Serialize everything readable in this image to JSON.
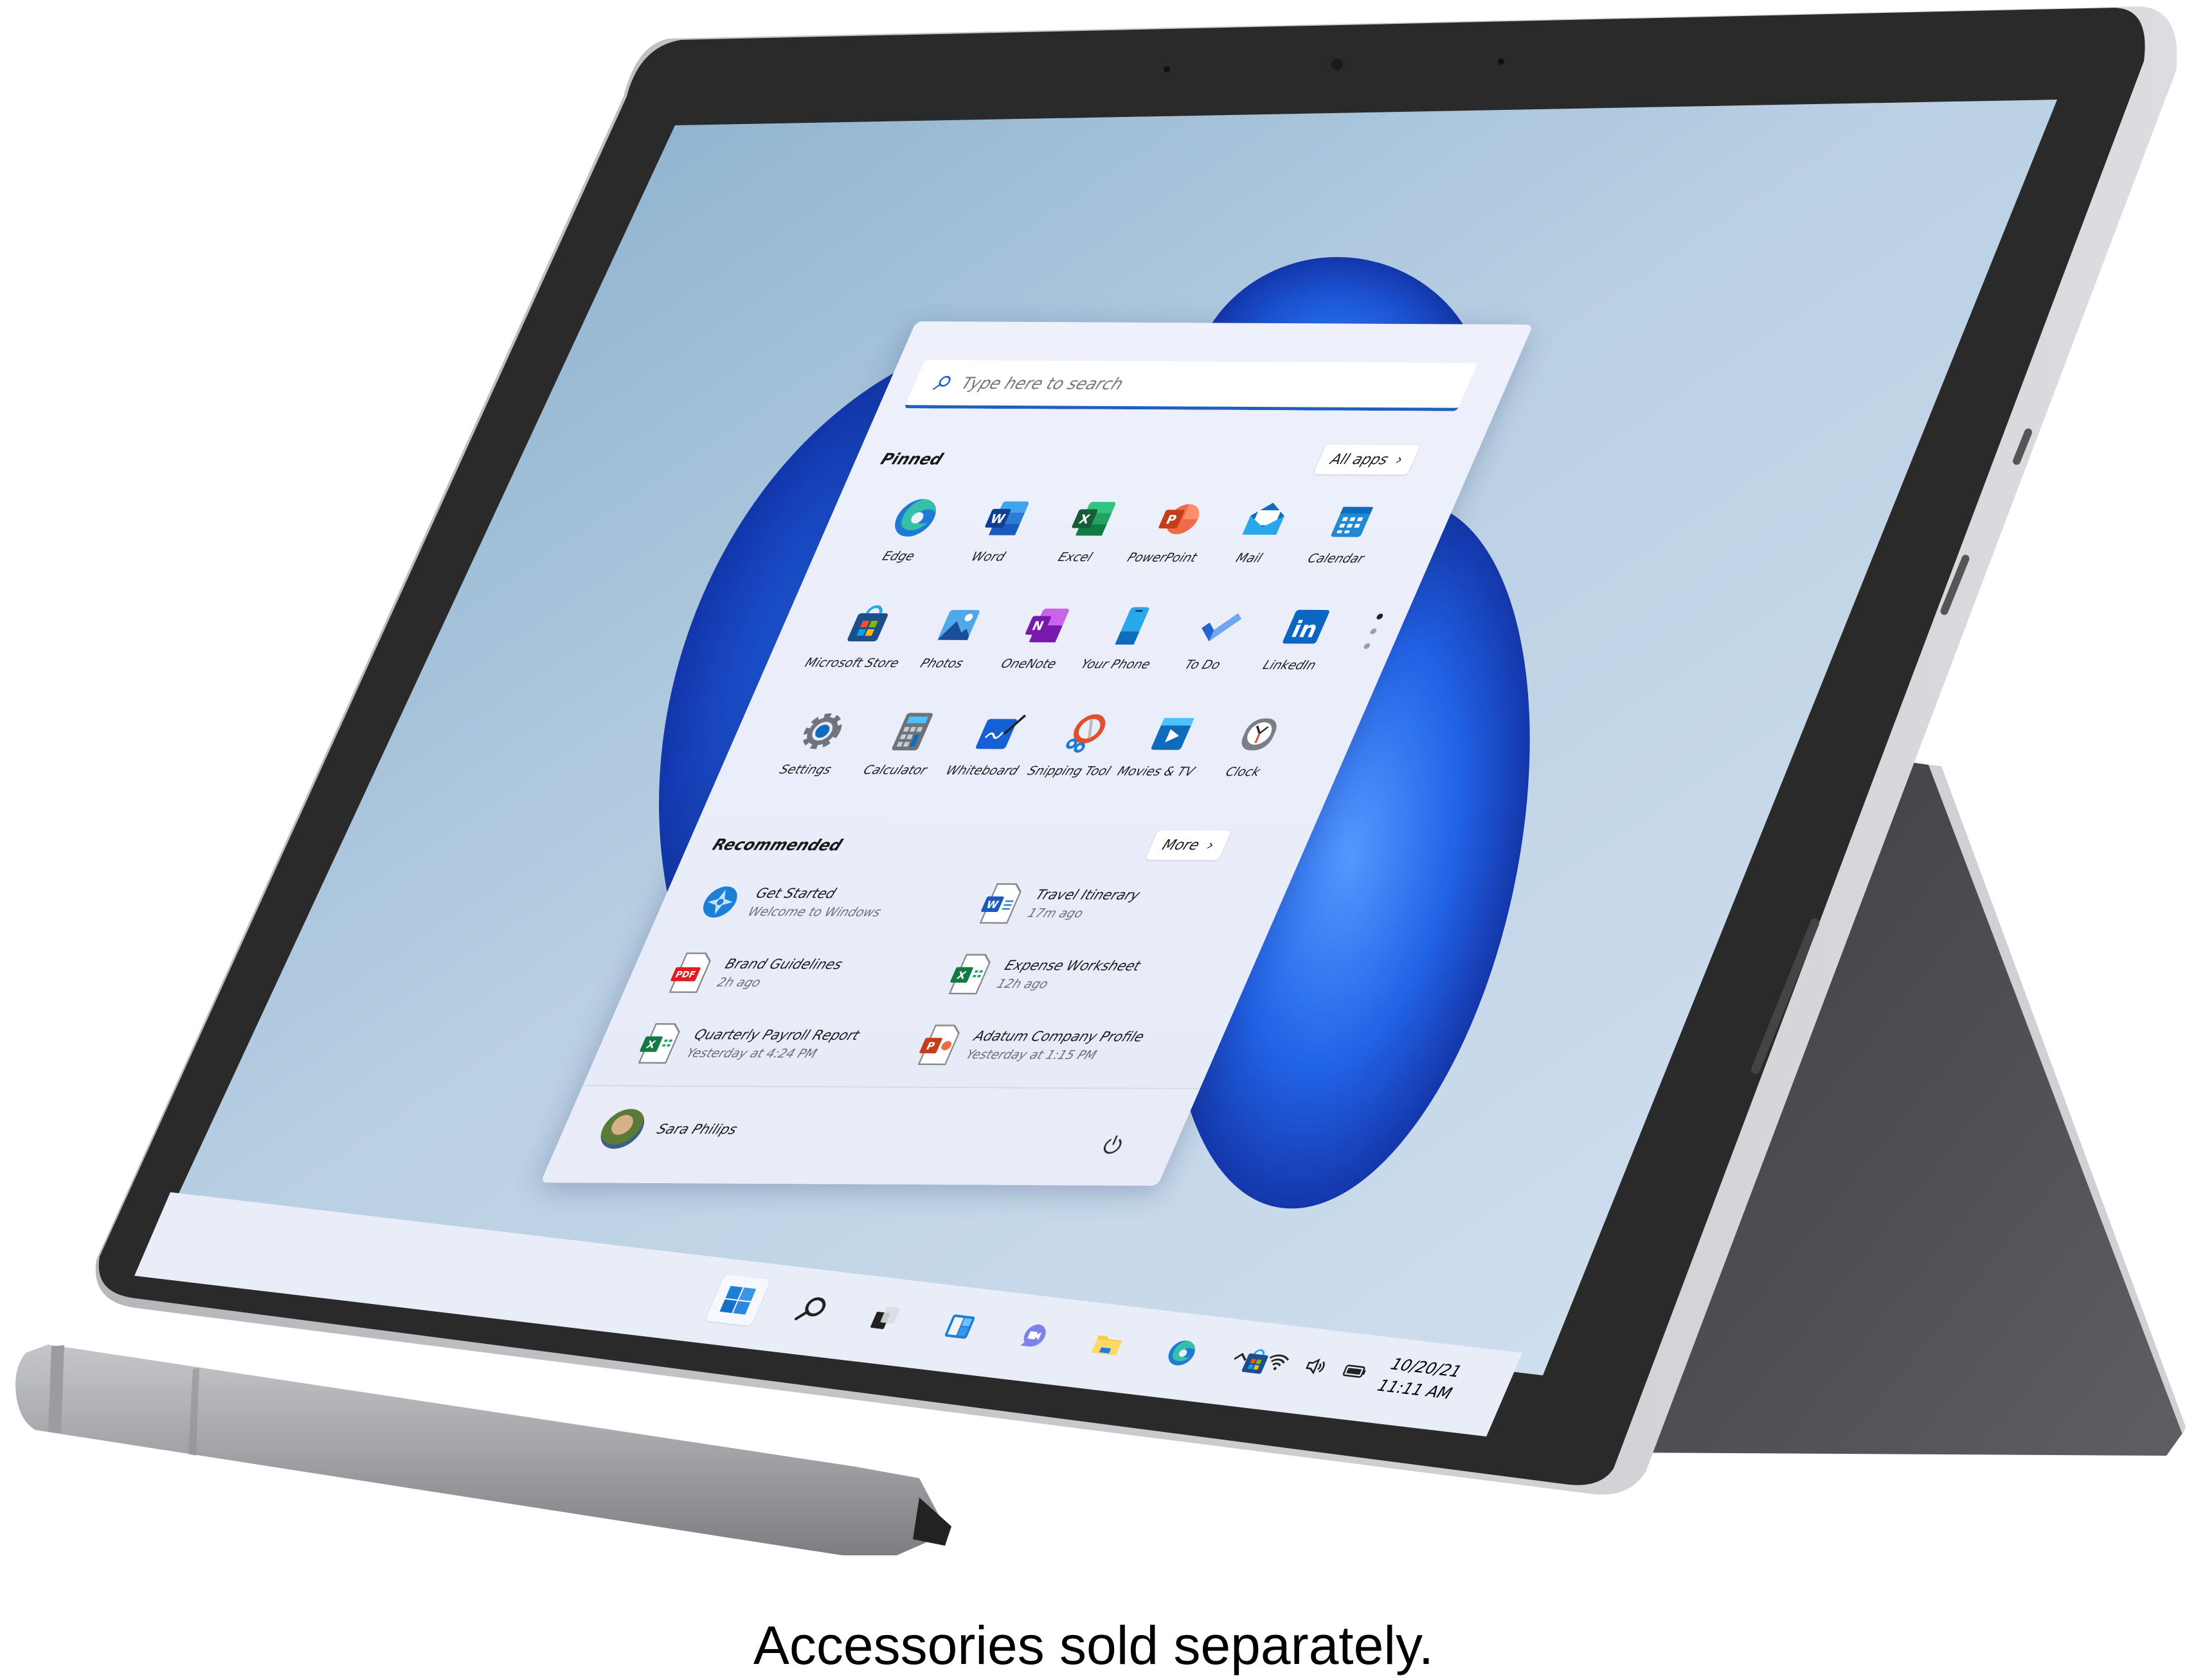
{
  "device": {
    "type": "tablet with kickstand and stylus pen",
    "colors": {
      "bezel": "#2a2a2a",
      "frame": "#c9cbcf",
      "kickstand": "#4d4f53",
      "pen": "#a4a6a9",
      "pen_tip": "#222222",
      "wallpaper": "#9fbfd9",
      "bloom": "#1a5ee8"
    }
  },
  "start_menu": {
    "search": {
      "placeholder": "Type here to search",
      "value": ""
    },
    "pinned": {
      "title": "Pinned",
      "all_apps_label": "All apps",
      "apps": [
        {
          "label": "Edge",
          "icon": "edge-icon"
        },
        {
          "label": "Word",
          "icon": "word-icon"
        },
        {
          "label": "Excel",
          "icon": "excel-icon"
        },
        {
          "label": "PowerPoint",
          "icon": "powerpoint-icon"
        },
        {
          "label": "Mail",
          "icon": "mail-icon"
        },
        {
          "label": "Calendar",
          "icon": "calendar-icon"
        },
        {
          "label": "Microsoft Store",
          "icon": "store-icon"
        },
        {
          "label": "Photos",
          "icon": "photos-icon"
        },
        {
          "label": "OneNote",
          "icon": "onenote-icon"
        },
        {
          "label": "Your Phone",
          "icon": "phone-icon"
        },
        {
          "label": "To Do",
          "icon": "todo-icon"
        },
        {
          "label": "LinkedIn",
          "icon": "linkedin-icon"
        },
        {
          "label": "Settings",
          "icon": "settings-icon"
        },
        {
          "label": "Calculator",
          "icon": "calculator-icon"
        },
        {
          "label": "Whiteboard",
          "icon": "whiteboard-icon"
        },
        {
          "label": "Snipping Tool",
          "icon": "snipping-tool-icon"
        },
        {
          "label": "Movies & TV",
          "icon": "movies-tv-icon"
        },
        {
          "label": "Clock",
          "icon": "clock-icon"
        }
      ],
      "page_indicator": {
        "pages": 3,
        "current": 1
      }
    },
    "recommended": {
      "title": "Recommended",
      "more_label": "More",
      "items": [
        {
          "title": "Get Started",
          "subtitle": "Welcome to Windows",
          "icon": "get-started-icon"
        },
        {
          "title": "Travel Itinerary",
          "subtitle": "17m ago",
          "icon": "word-doc-icon"
        },
        {
          "title": "Brand Guidelines",
          "subtitle": "2h ago",
          "icon": "pdf-doc-icon"
        },
        {
          "title": "Expense Worksheet",
          "subtitle": "12h ago",
          "icon": "excel-doc-icon"
        },
        {
          "title": "Quarterly Payroll Report",
          "subtitle": "Yesterday at 4:24 PM",
          "icon": "excel-doc-icon"
        },
        {
          "title": "Adatum Company Profile",
          "subtitle": "Yesterday at 1:15 PM",
          "icon": "powerpoint-doc-icon"
        }
      ]
    },
    "user": {
      "name": "Sara Philips"
    },
    "power_icon": "power-icon"
  },
  "taskbar": {
    "items": [
      {
        "name": "start",
        "icon": "windows-start-icon",
        "active": true
      },
      {
        "name": "search",
        "icon": "search-icon",
        "active": false
      },
      {
        "name": "task-view",
        "icon": "task-view-icon",
        "active": false
      },
      {
        "name": "widgets",
        "icon": "widgets-icon",
        "active": false
      },
      {
        "name": "chat",
        "icon": "chat-icon",
        "active": false
      },
      {
        "name": "file-explorer",
        "icon": "folder-icon",
        "active": false
      },
      {
        "name": "edge",
        "icon": "edge-icon",
        "active": false
      },
      {
        "name": "store",
        "icon": "store-icon",
        "active": false
      }
    ],
    "tray": {
      "icons": [
        "chevron-up-icon",
        "wifi-icon",
        "volume-icon",
        "battery-icon"
      ],
      "date": "10/20/21",
      "time": "11:11 AM"
    }
  },
  "caption": "Accessories sold separately."
}
